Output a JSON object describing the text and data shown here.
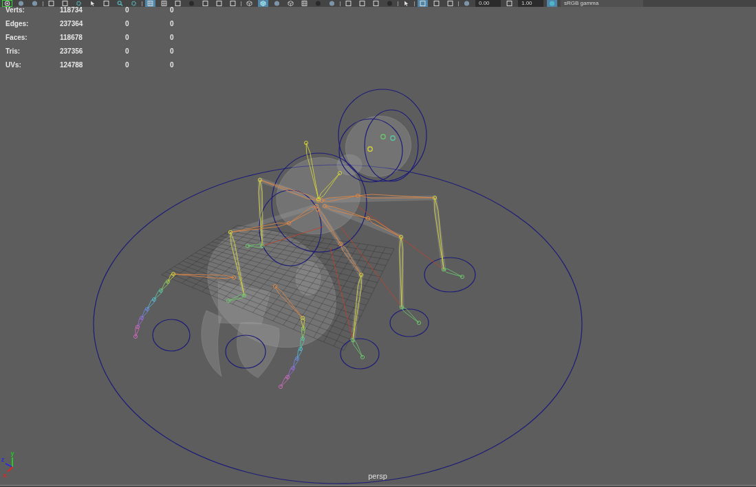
{
  "toolbar": {
    "groups": [
      {
        "items": [
          {
            "kind": "ring",
            "selected": false,
            "focused": true
          },
          {
            "kind": "sphere",
            "selected": false,
            "focused": false
          },
          {
            "kind": "sphere",
            "selected": false,
            "focused": false
          }
        ]
      },
      {
        "items": [
          {
            "kind": "square",
            "selected": false,
            "focused": false
          },
          {
            "kind": "square",
            "selected": false,
            "focused": false
          },
          {
            "kind": "gear",
            "selected": false,
            "focused": false
          },
          {
            "kind": "cursor",
            "selected": false,
            "focused": false
          },
          {
            "kind": "square",
            "selected": false,
            "focused": false
          },
          {
            "kind": "magnifier",
            "selected": false,
            "focused": false
          },
          {
            "kind": "gear",
            "selected": false,
            "focused": false
          }
        ]
      },
      {
        "items": [
          {
            "kind": "grid",
            "selected": true,
            "focused": false
          },
          {
            "kind": "grid",
            "selected": false,
            "focused": false
          },
          {
            "kind": "square",
            "selected": false,
            "focused": false
          },
          {
            "kind": "dot",
            "selected": false,
            "focused": false
          },
          {
            "kind": "square",
            "selected": false,
            "focused": false
          },
          {
            "kind": "square",
            "selected": false,
            "focused": false
          },
          {
            "kind": "square",
            "selected": false,
            "focused": false
          }
        ]
      },
      {
        "items": [
          {
            "kind": "cube",
            "selected": false,
            "focused": false
          },
          {
            "kind": "cube",
            "selected": true,
            "focused": false
          },
          {
            "kind": "sphere",
            "selected": false,
            "focused": false
          },
          {
            "kind": "cube",
            "selected": false,
            "focused": false
          },
          {
            "kind": "grid",
            "selected": false,
            "focused": false
          },
          {
            "kind": "dot",
            "selected": false,
            "focused": false
          },
          {
            "kind": "sphere",
            "selected": false,
            "focused": false
          }
        ]
      },
      {
        "items": [
          {
            "kind": "square",
            "selected": false,
            "focused": false
          },
          {
            "kind": "square",
            "selected": false,
            "focused": false
          },
          {
            "kind": "square",
            "selected": false,
            "focused": false
          },
          {
            "kind": "dot",
            "selected": false,
            "focused": false
          }
        ]
      },
      {
        "items": [
          {
            "kind": "cursor",
            "selected": false,
            "focused": false
          }
        ]
      },
      {
        "items": [
          {
            "kind": "square",
            "selected": true,
            "focused": false
          },
          {
            "kind": "square",
            "selected": false,
            "focused": false
          },
          {
            "kind": "square",
            "selected": false,
            "focused": false
          }
        ]
      },
      {
        "items": [
          {
            "kind": "sphere",
            "selected": false,
            "focused": false
          },
          {
            "kind": "field",
            "value": "0.00"
          },
          {
            "kind": "square",
            "selected": false,
            "focused": false
          },
          {
            "kind": "field",
            "value": "1.00"
          },
          {
            "kind": "sphere",
            "selected": true,
            "focused": false
          },
          {
            "kind": "dropdown",
            "value": "sRGB gamma"
          }
        ]
      }
    ]
  },
  "hud": {
    "rows": [
      {
        "label": "Verts:",
        "values": [
          "118734",
          "0",
          "0"
        ]
      },
      {
        "label": "Edges:",
        "values": [
          "237364",
          "0",
          "0"
        ]
      },
      {
        "label": "Faces:",
        "values": [
          "118678",
          "0",
          "0"
        ]
      },
      {
        "label": "Tris:",
        "values": [
          "237356",
          "0",
          "0"
        ]
      },
      {
        "label": "UVs:",
        "values": [
          "124788",
          "0",
          "0"
        ]
      }
    ]
  },
  "viewport": {
    "camera_label": "persp",
    "axes": [
      {
        "label": "z",
        "color": "#2a2ae0"
      },
      {
        "label": "y",
        "color": "#22cc22"
      },
      {
        "label": "x",
        "color": "#e02222"
      }
    ]
  }
}
